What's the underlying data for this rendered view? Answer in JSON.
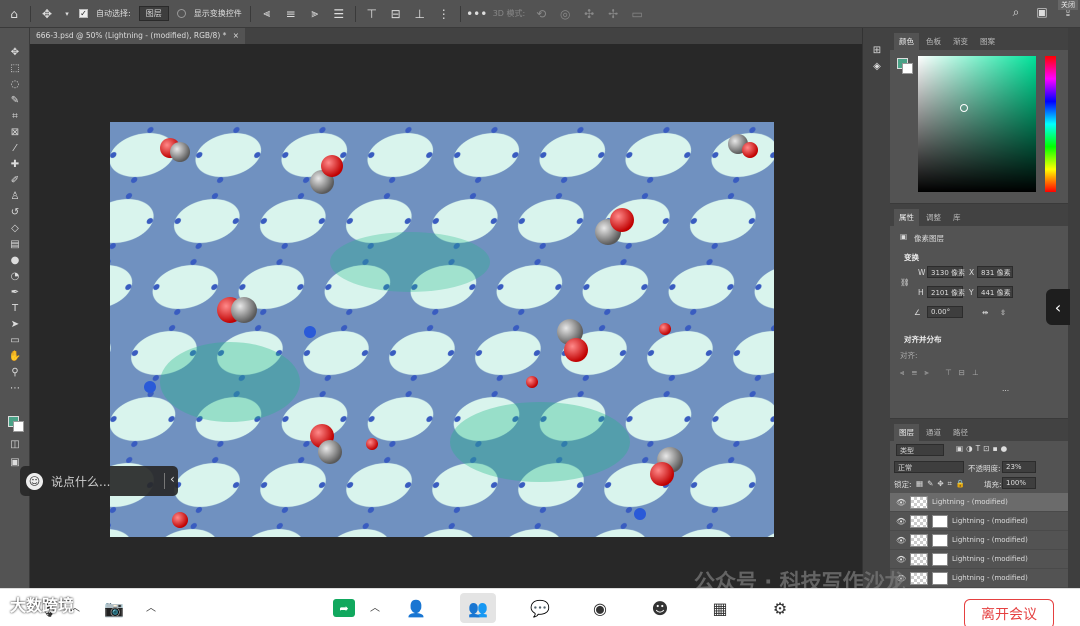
{
  "options_bar": {
    "auto_select_label": "自动选择:",
    "auto_select_mode": "图层",
    "show_transform_label": "显示变换控件",
    "three_d_mode_label": "3D 模式:",
    "close_label": "关闭"
  },
  "document_tab": {
    "title": "666-3.psd @ 50% (Lightning -  (modified), RGB/8) *"
  },
  "color_panel": {
    "tabs": [
      "颜色",
      "色板",
      "渐变",
      "图案"
    ],
    "foreground": "#4aa287",
    "background": "#ffffff"
  },
  "properties_panel": {
    "tabs": [
      "属性",
      "调整",
      "库"
    ],
    "layer_type": "像素图层",
    "transform_label": "变换",
    "w_label": "W",
    "w_value": "3130 像素",
    "x_label": "X",
    "x_value": "831 像素",
    "h_label": "H",
    "h_value": "2101 像素",
    "y_label": "Y",
    "y_value": "441 像素",
    "angle_value": "0.00°",
    "align_label": "对齐并分布",
    "align_sub": "对齐:",
    "more": "..."
  },
  "layers_panel": {
    "tabs": [
      "图层",
      "通道",
      "路径"
    ],
    "filter_kind": "类型",
    "blend_mode": "正常",
    "opacity_label": "不透明度:",
    "opacity_value": "23%",
    "lock_label": "锁定:",
    "fill_label": "填充:",
    "fill_value": "100%",
    "layers": [
      {
        "name": "Lightning -    (modified)"
      },
      {
        "name": "Lightning -    (modified)"
      },
      {
        "name": "Lightning -    (modified)"
      },
      {
        "name": "Lightning -    (modified)"
      },
      {
        "name": "Lightning -    (modified)"
      }
    ]
  },
  "chat": {
    "placeholder": "说点什么..."
  },
  "meeting_bar": {
    "leave_label": "离开会议"
  },
  "watermark": {
    "text": "公众号 · 科技写作沙龙",
    "logo_text": "大数跨境"
  }
}
